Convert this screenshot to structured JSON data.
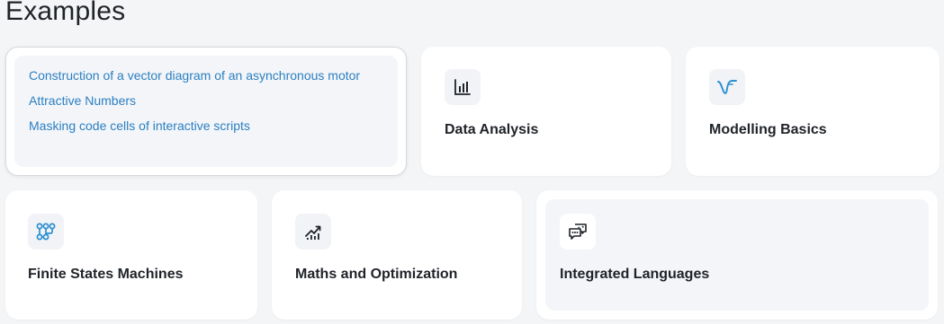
{
  "page_title": "Examples",
  "cards": {
    "examples_list": {
      "links": [
        "Construction of a vector diagram of an asynchronous motor",
        "Attractive Numbers",
        "Masking code cells of interactive scripts"
      ]
    },
    "data_analysis": {
      "title": "Data Analysis",
      "icon": "bar-chart-icon"
    },
    "modelling_basics": {
      "title": "Modelling Basics",
      "icon": "model-curve-icon"
    },
    "finite_states": {
      "title": "Finite States Machines",
      "icon": "state-graph-icon"
    },
    "maths_optimization": {
      "title": "Maths and Optimization",
      "icon": "trend-chart-icon"
    },
    "integrated_languages": {
      "title": "Integrated Languages",
      "icon": "code-chat-icon"
    }
  },
  "colors": {
    "link": "#2b7fc2",
    "accent_icon": "#2b8fd0",
    "text": "#1f2328",
    "background": "#f4f5f7"
  }
}
